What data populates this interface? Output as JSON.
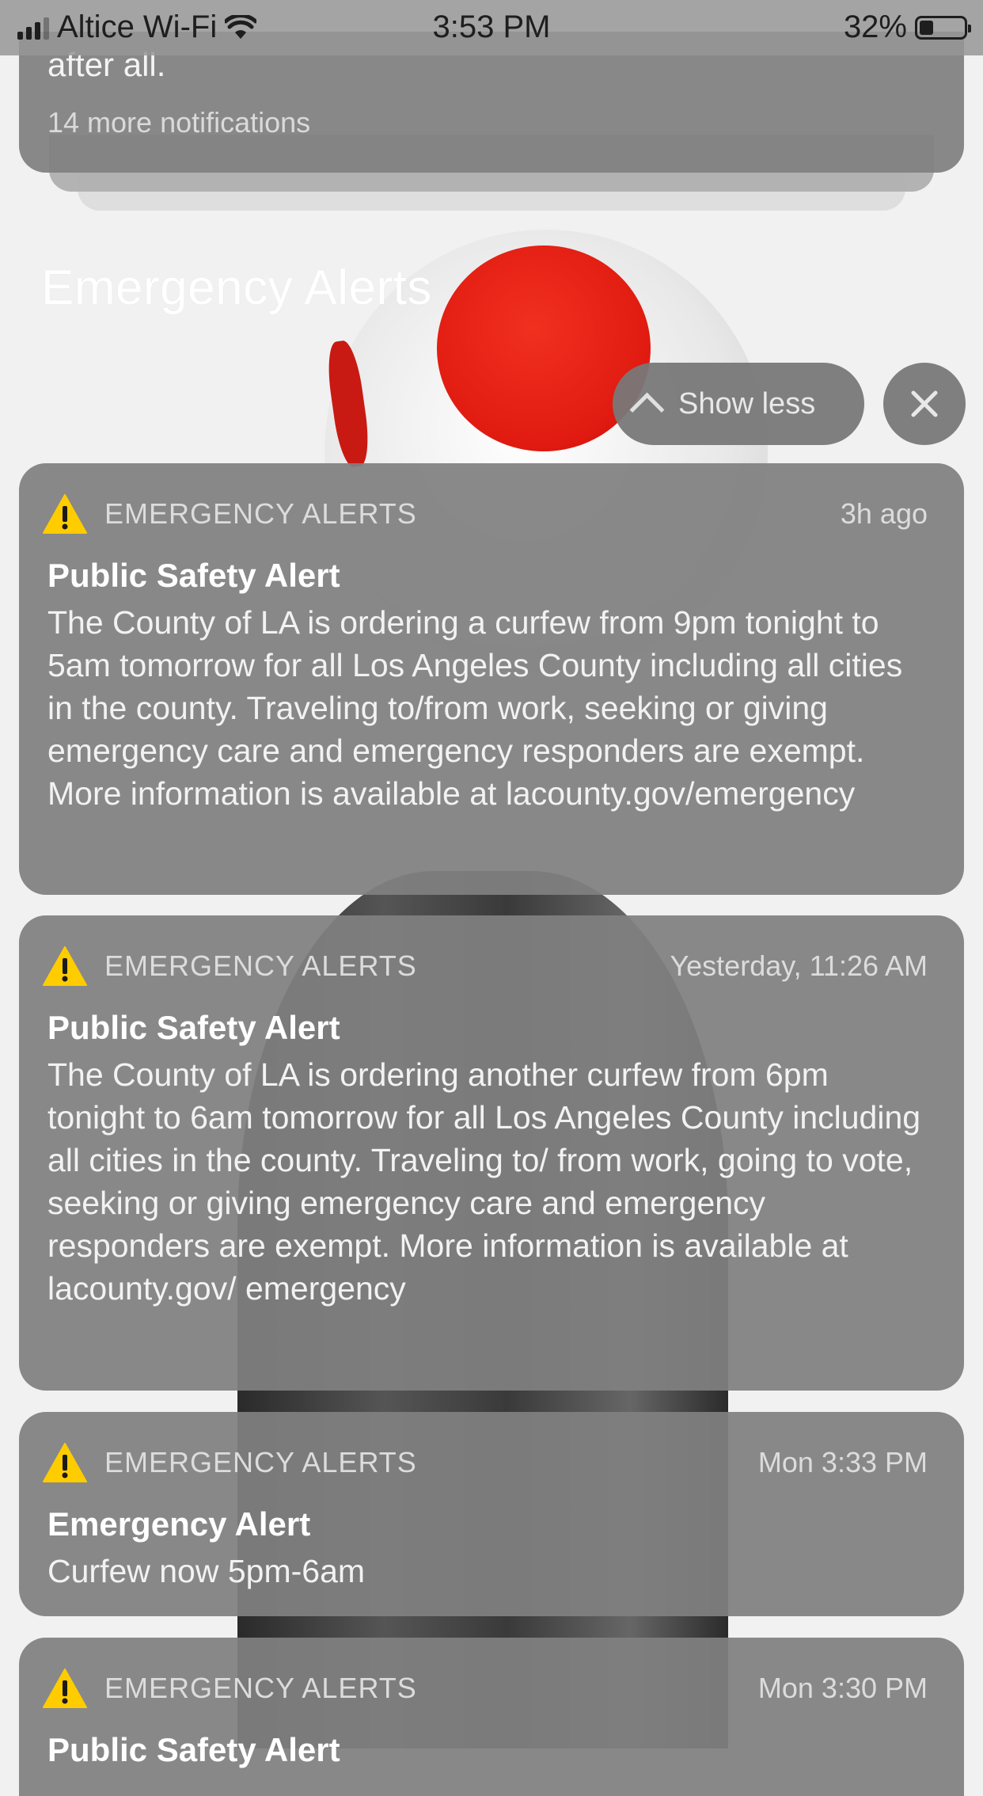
{
  "status_bar": {
    "carrier": "Altice Wi-Fi",
    "time": "3:53 PM",
    "battery": "32%",
    "battery_level": 0.32,
    "icons": [
      "signal-icon",
      "wifi-icon",
      "battery-icon"
    ]
  },
  "top_stack": {
    "fragment": "after all.",
    "more_label": "14 more notifications"
  },
  "group": {
    "title": "Emergency Alerts",
    "show_less_label": "Show less"
  },
  "notifications": [
    {
      "app": "EMERGENCY ALERTS",
      "time": "3h ago",
      "title": "Public Safety Alert",
      "body": "The County of LA is ordering a curfew from 9pm tonight to 5am tomorrow for all Los Angeles County including all cities in the county. Traveling to/from work, seeking or giving emergency care and emergency responders are exempt. More information is available at lacounty.gov/emergency"
    },
    {
      "app": "EMERGENCY ALERTS",
      "time": "Yesterday, 11:26 AM",
      "title": "Public Safety Alert",
      "body": "The County of LA is ordering another curfew from 6pm tonight to 6am tomorrow for all Los Angeles County including all cities in the county. Traveling to/ from work, going to vote, seeking or giving emergency care and emergency responders are exempt. More information is available at lacounty.gov/ emergency"
    },
    {
      "app": "EMERGENCY ALERTS",
      "time": "Mon 3:33 PM",
      "title": "Emergency Alert",
      "body": "Curfew now 5pm-6am"
    },
    {
      "app": "EMERGENCY ALERTS",
      "time": "Mon 3:30 PM",
      "title": "Public Safety Alert",
      "body": ""
    }
  ],
  "colors": {
    "warning_yellow": "#ffcc00",
    "card_background": "#808080"
  }
}
